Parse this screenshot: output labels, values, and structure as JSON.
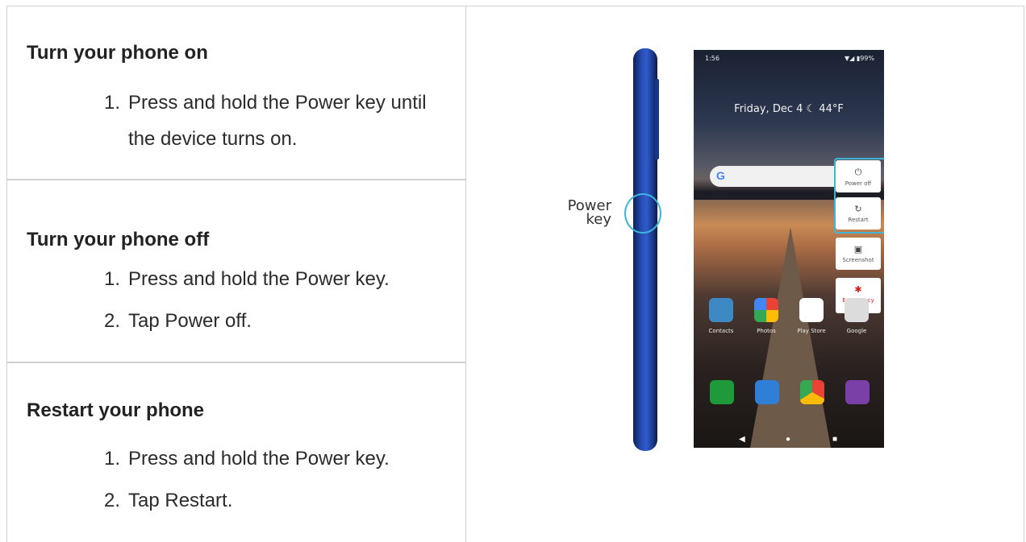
{
  "sections": [
    {
      "title": "Turn your phone on",
      "steps": [
        {
          "num": "1.",
          "text": "Press and hold the Power key until the device turns on."
        }
      ]
    },
    {
      "title": "Turn your phone off",
      "steps": [
        {
          "num": "1.",
          "text": "Press and hold the Power key."
        },
        {
          "num": "2.",
          "text": "Tap Power off."
        }
      ]
    },
    {
      "title": "Restart your phone",
      "steps": [
        {
          "num": "1.",
          "text": "Press and hold the Power key."
        },
        {
          "num": "2.",
          "text": "Tap Restart."
        }
      ]
    }
  ],
  "illustration": {
    "power_key_label_1": "Power",
    "power_key_label_2": "key",
    "status_time": "1:56",
    "status_right": "▼◢ ▮99%",
    "date_text": "Friday, Dec 4  ☾  44°F",
    "google_letter": "G",
    "power_menu": {
      "power_off": "Power off",
      "restart": "Restart",
      "screenshot": "Screenshot",
      "emergency": "Emergency"
    },
    "apps": [
      "Contacts",
      "Photos",
      "Play Store",
      "Google"
    ],
    "colors": {
      "highlight": "#3fb6d8",
      "phone_body": "#2f5ccc",
      "emergency": "#d32121"
    }
  }
}
